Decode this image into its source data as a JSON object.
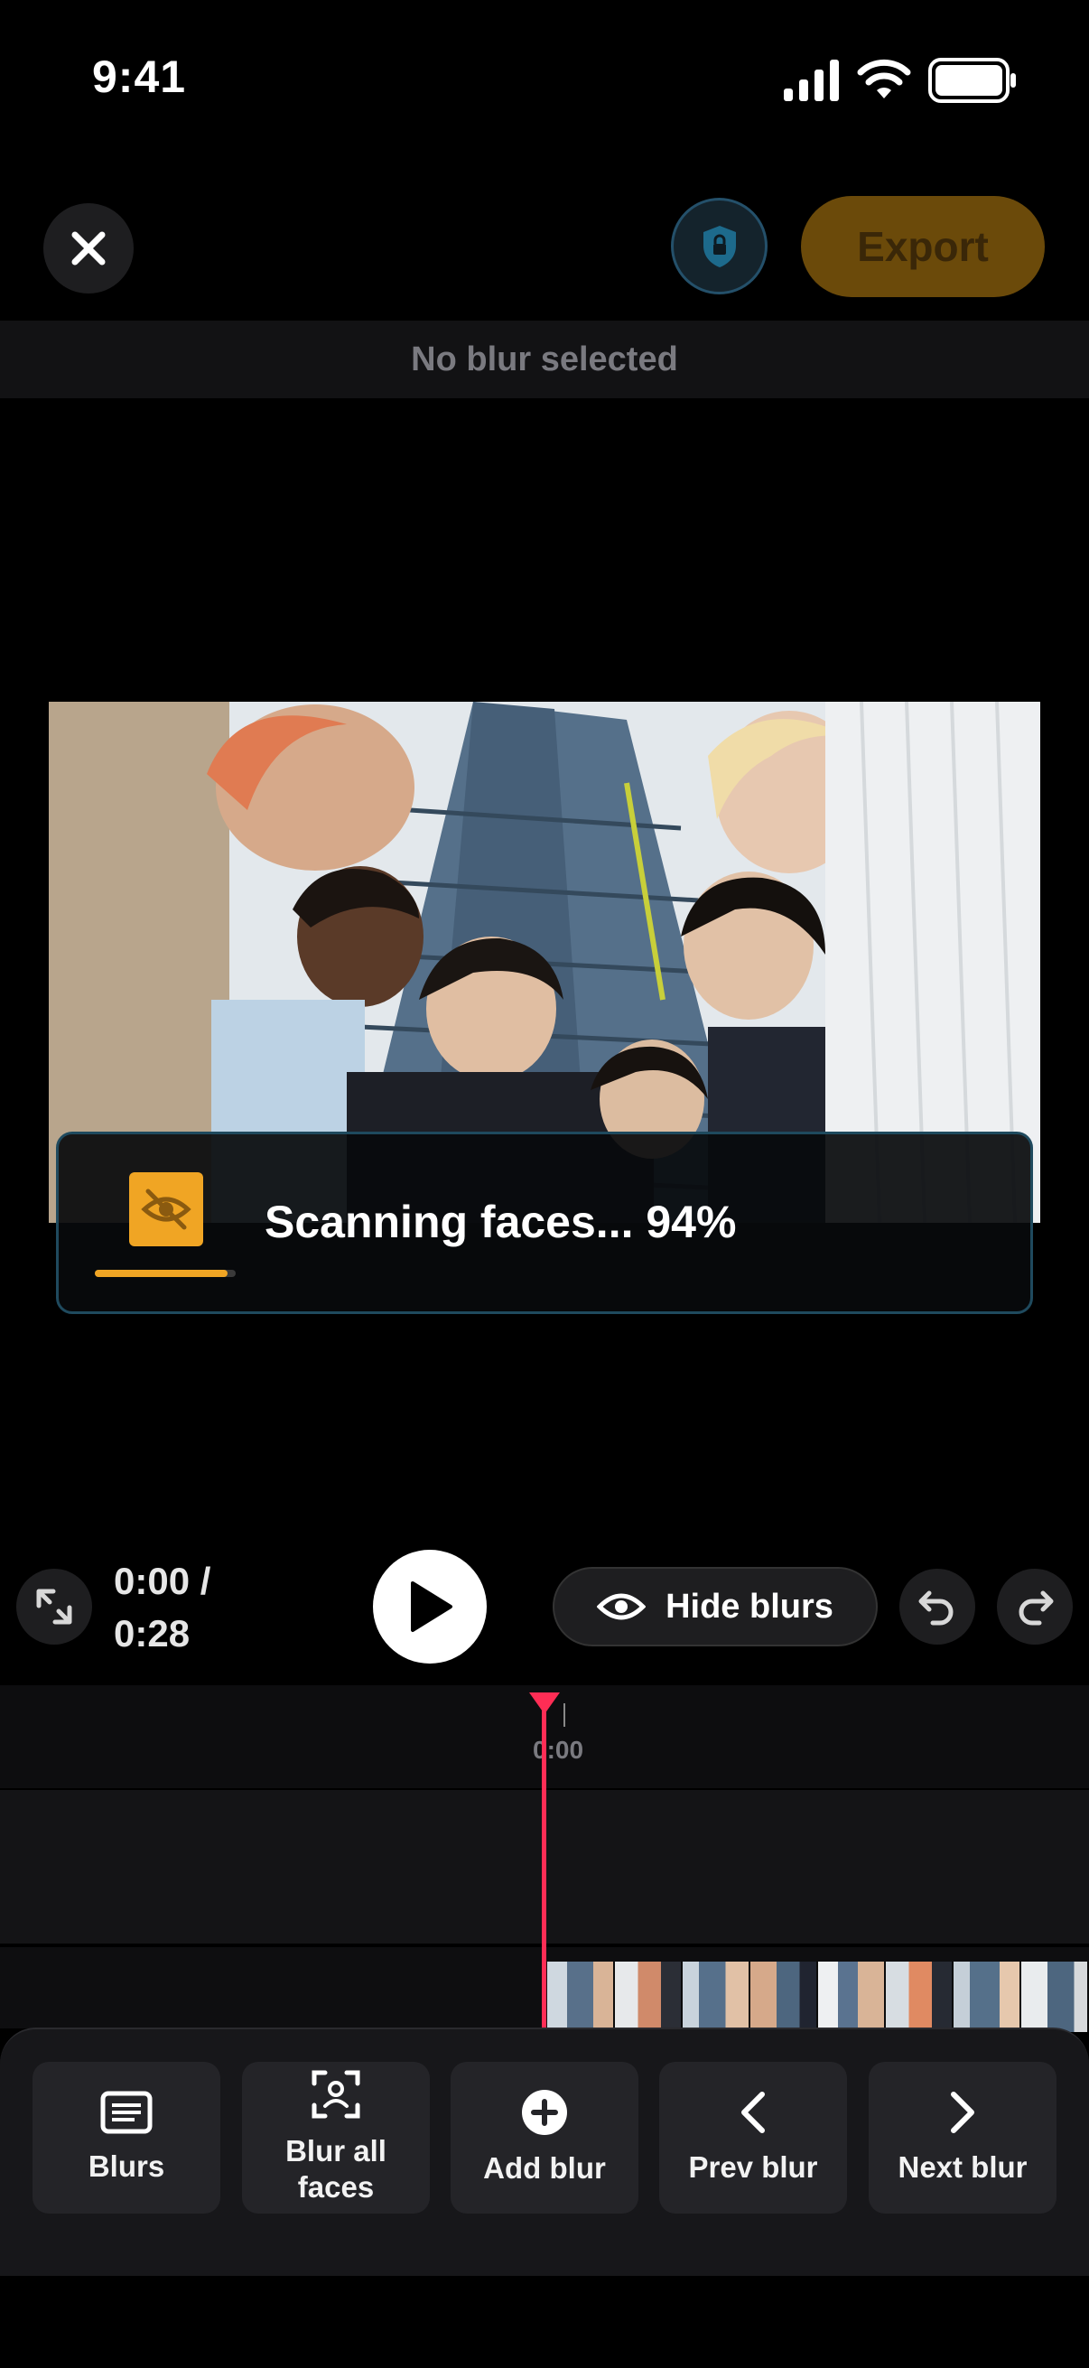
{
  "status_bar": {
    "time": "9:41",
    "icons": [
      "signal-icon",
      "wifi-icon",
      "battery-icon"
    ]
  },
  "top_bar": {
    "close_icon": "close-icon",
    "shield_icon": "lock-shield-icon",
    "export_label": "Export"
  },
  "selection": {
    "text": "No blur selected"
  },
  "scan": {
    "text": "Scanning faces... 94%",
    "progress": 0.94,
    "icon": "eye-off-icon",
    "accent": "#f0a524"
  },
  "player": {
    "time_current": "0:00 /",
    "time_total": "0:28",
    "hide_label": "Hide blurs",
    "icons": [
      "fullscreen-icon",
      "play-icon",
      "eye-icon",
      "undo-icon",
      "redo-icon"
    ]
  },
  "timeline": {
    "ruler_label": "0:00",
    "playhead_color": "#ff2d55"
  },
  "toolbar": {
    "items": [
      {
        "label": "Blurs",
        "icon": "list-icon"
      },
      {
        "label": "Blur all faces",
        "icon": "face-scan-icon"
      },
      {
        "label": "Add blur",
        "icon": "plus-circle-icon"
      },
      {
        "label": "Prev blur",
        "icon": "chevron-left-icon"
      },
      {
        "label": "Next blur",
        "icon": "chevron-right-icon"
      }
    ]
  },
  "colors": {
    "background": "#000000",
    "accent": "#f0a524",
    "export_bg": "#6b4a0a",
    "playhead": "#ff2d55"
  }
}
